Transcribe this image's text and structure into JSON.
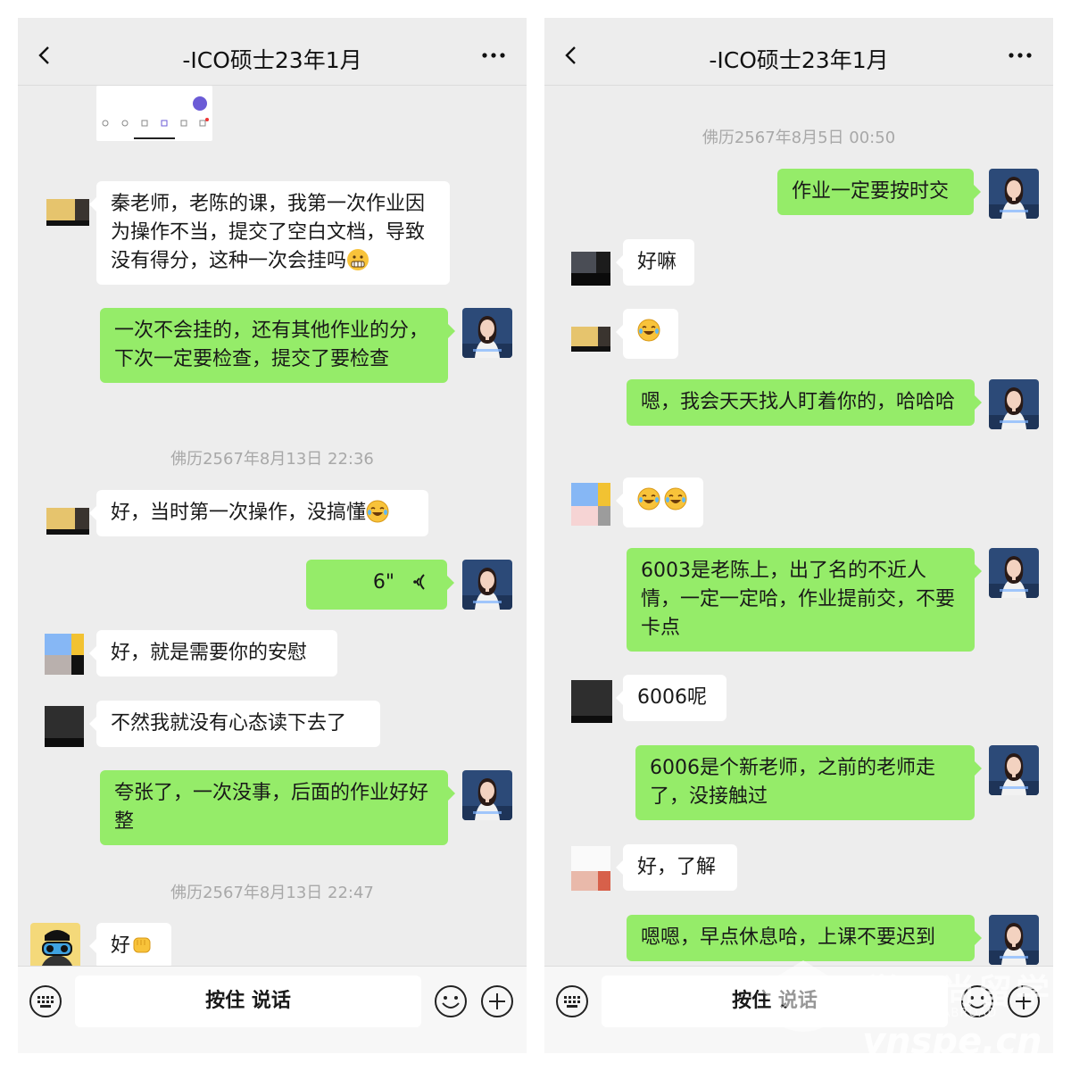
{
  "left": {
    "title": "-ICO硕士23年1月",
    "msgs": {
      "m1": "秦老师，老陈的课，我第一次作业因为操作不当，提交了空白文档，导致没有得分，这种一次会挂吗",
      "m2": "一次不会挂的，还有其他作业的分，下次一定要检查，提交了要检查",
      "ts1": "佛历2567年8月13日 22:36",
      "m3": "好，当时第一次操作，没搞懂",
      "voice": "6\"",
      "m4": "好，就是需要你的安慰",
      "m5": "不然我就没有心态读下去了",
      "m6": "夸张了，一次没事，后面的作业好好整",
      "ts2": "佛历2567年8月13日 22:47",
      "m7": "好"
    },
    "hold": "按住 说话"
  },
  "right": {
    "title": "-ICO硕士23年1月",
    "msgs": {
      "ts1": "佛历2567年8月5日 00:50",
      "r1": "作业一定要按时交",
      "r2": "好嘛",
      "r3": "嗯，我会天天找人盯着你的，哈哈哈",
      "r4": "6003是老陈上，出了名的不近人情，一定一定哈，作业提前交，不要卡点",
      "r5": "6006呢",
      "r6": "6006是个新老师，之前的老师走了，没接触过",
      "r7": "好，了解",
      "r8": "嗯嗯，早点休息哈，上课不要迟到"
    },
    "hold": "按住 说话"
  },
  "watermark": {
    "line1": "学子尚留学",
    "line2": "SPE STUDY ABROAD",
    "line3": "ynspe.cn"
  },
  "colors": {
    "outgoing": "#95ec69",
    "incoming": "#ffffff",
    "background": "#ededed"
  },
  "icons": [
    "back-icon",
    "more-icon",
    "keyboard-icon",
    "smile-icon",
    "plus-icon",
    "voice-icon"
  ]
}
